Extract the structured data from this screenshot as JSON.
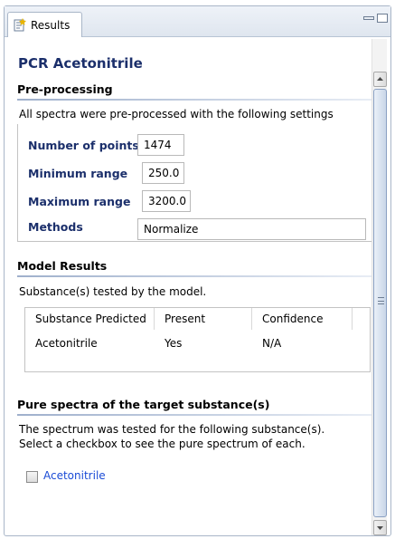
{
  "tab": {
    "label": "Results",
    "icon": "results-icon"
  },
  "report": {
    "title": "PCR Acetonitrile"
  },
  "preprocessing": {
    "heading": "Pre-processing",
    "description": "All spectra were pre-processed with the following settings",
    "params": [
      {
        "label": "Number of points",
        "value": "1474"
      },
      {
        "label": "Minimum range",
        "value": "250.0"
      },
      {
        "label": "Maximum range",
        "value": "3200.0"
      },
      {
        "label": "Methods",
        "value": "Normalize"
      }
    ]
  },
  "model_results": {
    "heading": "Model Results",
    "description": "Substance(s) tested by the model.",
    "columns": [
      "Substance Predicted",
      "Present",
      "Confidence"
    ],
    "rows": [
      [
        "Acetonitrile",
        "Yes",
        "N/A"
      ]
    ]
  },
  "pure_spectra": {
    "heading": "Pure spectra of the target substance(s)",
    "line1": "The spectrum was tested for the following substance(s).",
    "line2": "Select a checkbox to see the pure spectrum of each.",
    "checkbox_label": "Acetonitrile",
    "checkbox_checked": false
  },
  "colors": {
    "title": "#1b2f6b",
    "param_label": "#1b2f6b",
    "link": "#1a4bd6"
  }
}
